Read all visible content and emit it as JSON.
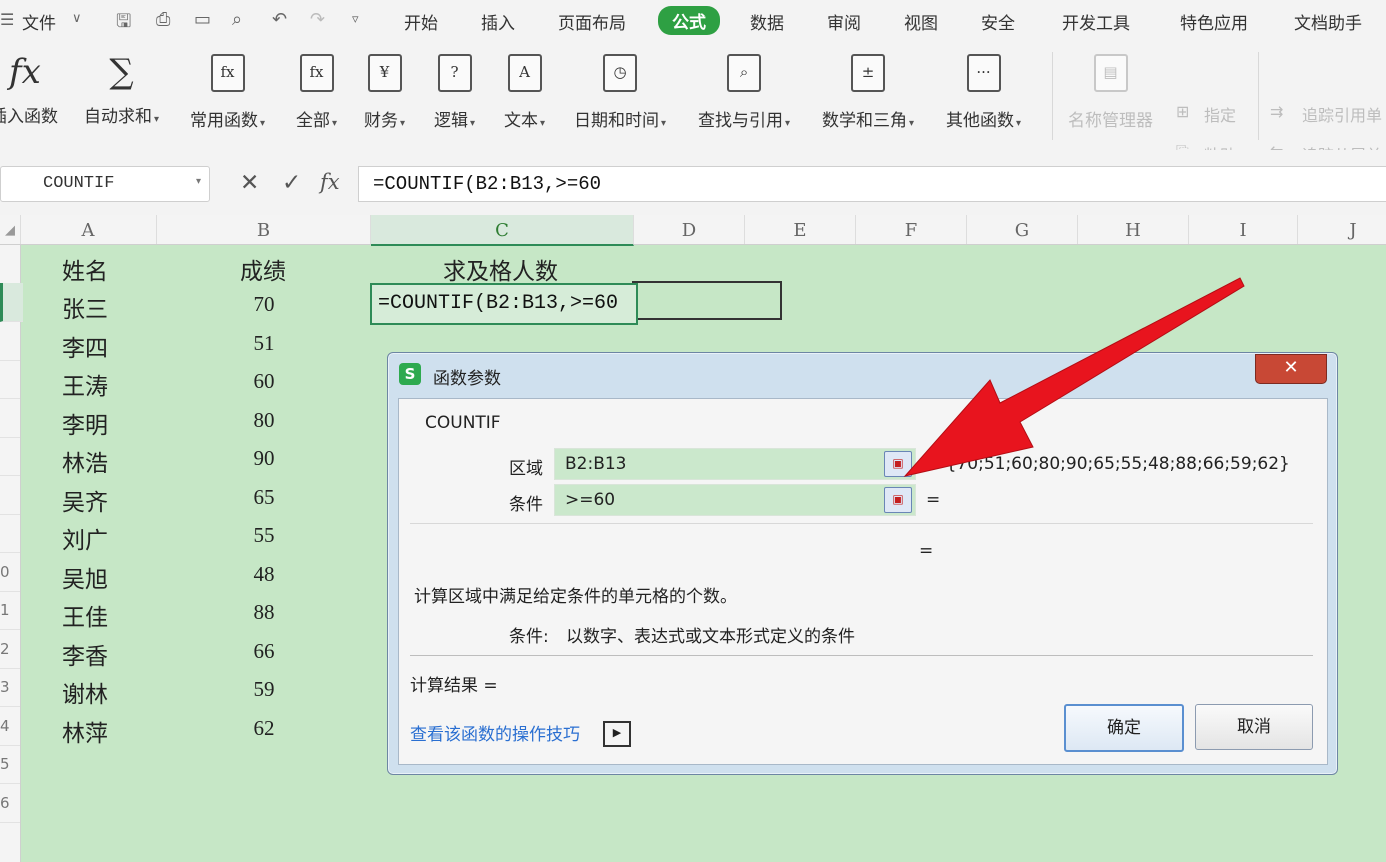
{
  "menubar": {
    "file": "文件",
    "tabs": [
      "开始",
      "插入",
      "页面布局",
      "公式",
      "数据",
      "审阅",
      "视图",
      "安全",
      "开发工具",
      "特色应用",
      "文档助手"
    ],
    "active_tab": "公式"
  },
  "ribbon": {
    "insert_function": "插入函数",
    "autosum": "自动求和",
    "common": "常用函数",
    "all": "全部",
    "finance": "财务",
    "logic": "逻辑",
    "text": "文本",
    "datetime": "日期和时间",
    "lookup": "查找与引用",
    "math": "数学和三角",
    "other": "其他函数",
    "name_manager": "名称管理器",
    "pin": "指定",
    "paste": "粘贴",
    "trace_precedents": "追踪引用单",
    "trace_dependents": "追踪从属单"
  },
  "formula_bar": {
    "name_box": "COUNTIF",
    "formula": "=COUNTIF(B2:B13,>=60"
  },
  "columns": [
    "A",
    "B",
    "C",
    "D",
    "E",
    "F",
    "G",
    "H",
    "I",
    "J"
  ],
  "row_numbers": [
    "",
    "",
    "",
    "",
    "",
    "",
    "",
    "",
    "0",
    "1",
    "2",
    "3",
    "4",
    "5",
    "6"
  ],
  "sheet": {
    "header_name": "姓名",
    "header_score": "成绩",
    "header_pass": "求及格人数",
    "active_cell_text": "=COUNTIF(B2:B13,>=60",
    "rows": [
      {
        "name": "张三",
        "score": "70"
      },
      {
        "name": "李四",
        "score": "51"
      },
      {
        "name": "王涛",
        "score": "60"
      },
      {
        "name": "李明",
        "score": "80"
      },
      {
        "name": "林浩",
        "score": "90"
      },
      {
        "name": "吴齐",
        "score": "65"
      },
      {
        "name": "刘广",
        "score": "55"
      },
      {
        "name": "吴旭",
        "score": "48"
      },
      {
        "name": "王佳",
        "score": "88"
      },
      {
        "name": "李香",
        "score": "66"
      },
      {
        "name": "谢林",
        "score": "59"
      },
      {
        "name": "林萍",
        "score": "62"
      }
    ]
  },
  "dialog": {
    "title": "函数参数",
    "function_name": "COUNTIF",
    "arg1_label": "区域",
    "arg1_value": "B2:B13",
    "arg1_result": "= {70;51;60;80;90;65;55;48;88;66;59;62}",
    "arg2_label": "条件",
    "arg2_value": ">=60",
    "arg2_result": "=",
    "func_result": "=",
    "description": "计算区域中满足给定条件的单元格的个数。",
    "arg_help_label": "条件:",
    "arg_help_text": "以数字、表达式或文本形式定义的条件",
    "calc_result_label": "计算结果  =",
    "tip_link": "查看该函数的操作技巧",
    "ok": "确定",
    "cancel": "取消"
  },
  "colors": {
    "sheet_bg": "#c6e7c6",
    "active_tab": "#2ea043",
    "arrow": "#e8141e"
  }
}
